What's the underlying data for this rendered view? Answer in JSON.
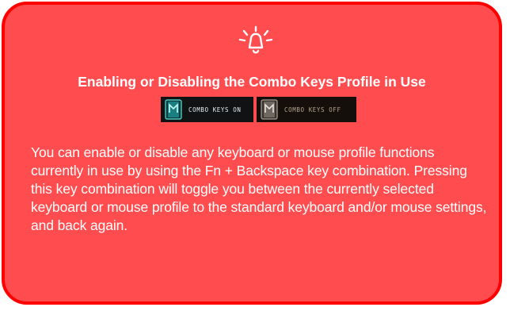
{
  "colors": {
    "panel_background": "#ff4c4e",
    "panel_border": "#ff0000",
    "text": "#ffffff"
  },
  "icon": "bell-icon",
  "title": "Enabling or Disabling the Combo Keys Profile in Use",
  "badges": {
    "on_label": "COMBO KEYS ON",
    "off_label": "COMBO KEYS OFF"
  },
  "body": "You can enable or disable any keyboard or mouse profile functions currently in use by using the Fn + Backspace key combination. Pressing this key combination will toggle you between the currently selected keyboard or mouse profile to the standard keyboard and/or mouse settings, and back again."
}
